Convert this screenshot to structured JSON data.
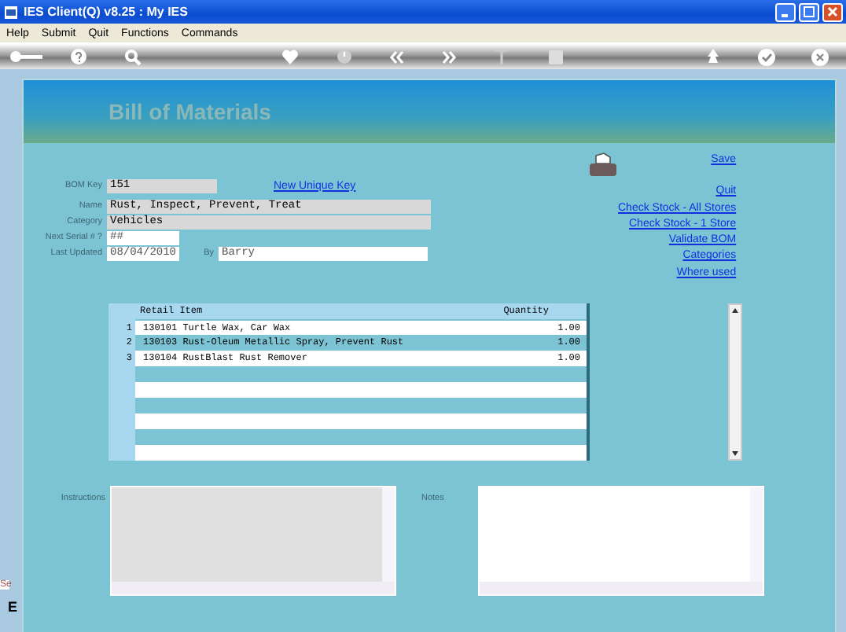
{
  "window": {
    "title": "IES Client(Q) v8.25 : My IES"
  },
  "menu": [
    "Help",
    "Submit",
    "Quit",
    "Functions",
    "Commands"
  ],
  "page": {
    "title": "Bill of Materials"
  },
  "form": {
    "bom_key": {
      "label": "BOM Key",
      "value": "151"
    },
    "new_key_link": "New Unique Key",
    "name": {
      "label": "Name",
      "value": "Rust, Inspect, Prevent, Treat"
    },
    "category": {
      "label": "Category",
      "value": "Vehicles"
    },
    "next_serial": {
      "label": "Next Serial # ?",
      "value": "##"
    },
    "last_updated": {
      "label": "Last Updated",
      "value": "08/04/2010"
    },
    "by": {
      "label": "By",
      "value": "Barry"
    }
  },
  "save_link": "Save",
  "links": [
    "Quit",
    "Check Stock - All Stores",
    "Check Stock - 1 Store",
    "Validate BOM",
    "Categories",
    "Where used"
  ],
  "table": {
    "columns": [
      "Retail Item",
      "Quantity"
    ],
    "rows": [
      {
        "number": "1",
        "item": "130101 Turtle Wax, Car Wax",
        "quantity": "1.00"
      },
      {
        "number": "2",
        "item": "130103 Rust-Oleum Metallic Spray, Prevent Rust",
        "quantity": "1.00"
      },
      {
        "number": "3",
        "item": "130104 RustBlast Rust Remover",
        "quantity": "1.00"
      }
    ]
  },
  "instructions": {
    "label": "Instructions",
    "disabled": true
  },
  "notes": {
    "label": "Notes",
    "disabled": false
  },
  "left_stub": [
    "Se",
    "E"
  ]
}
